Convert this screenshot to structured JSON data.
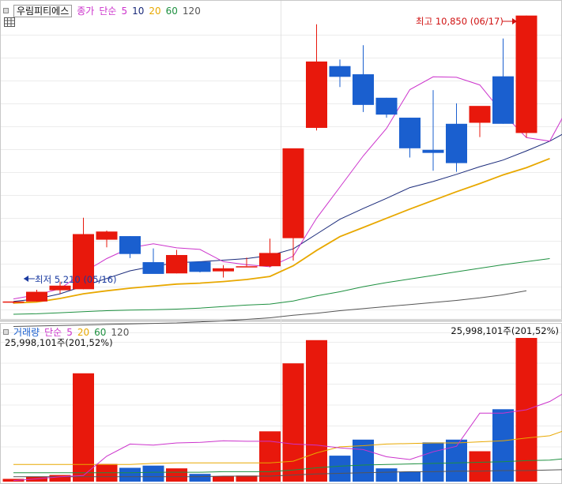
{
  "header": {
    "stock_name": "우림피티에스",
    "price_label": "종가",
    "ma_type": "단순",
    "ma_periods": [
      "5",
      "10",
      "20",
      "60",
      "120"
    ]
  },
  "volume_header": {
    "label": "거래량",
    "ma_type": "단순",
    "ma_periods": [
      "5",
      "20",
      "60",
      "120"
    ],
    "current_left": "25,998,101주(201,52%)",
    "current_right": "25,998,101주(201,52%)"
  },
  "annotations": {
    "high": "최고 10,850 (06/17)",
    "low": "최저 5,210 (05/16)"
  },
  "colors": {
    "up": "#e8180c",
    "down": "#1a5fcf",
    "ma5": "#cc33cc",
    "ma10": "#1a2a7a",
    "ma20": "#e8a800",
    "ma60": "#1e9040",
    "ma120": "#555555",
    "vma5": "#cc33cc",
    "vma20": "#e8a800",
    "vma60": "#1e9040",
    "vma120": "#555555"
  },
  "chart_data": {
    "type": "candlestick",
    "price_range": [
      5000,
      11000
    ],
    "candles": [
      {
        "o": 5250,
        "h": 5250,
        "l": 5210,
        "c": 5250
      },
      {
        "o": 5250,
        "h": 5480,
        "l": 5250,
        "c": 5440
      },
      {
        "o": 5470,
        "h": 5640,
        "l": 5400,
        "c": 5560
      },
      {
        "o": 5490,
        "h": 6890,
        "l": 5490,
        "c": 6570
      },
      {
        "o": 6460,
        "h": 6640,
        "l": 6310,
        "c": 6620
      },
      {
        "o": 6530,
        "h": 6530,
        "l": 6100,
        "c": 6180
      },
      {
        "o": 6020,
        "h": 6290,
        "l": 5820,
        "c": 5790
      },
      {
        "o": 5800,
        "h": 6260,
        "l": 5800,
        "c": 6160
      },
      {
        "o": 6030,
        "h": 6030,
        "l": 5820,
        "c": 5830
      },
      {
        "o": 5840,
        "h": 5960,
        "l": 5720,
        "c": 5900
      },
      {
        "o": 5940,
        "h": 6110,
        "l": 5940,
        "c": 5940
      },
      {
        "o": 5940,
        "h": 6480,
        "l": 5920,
        "c": 6200
      },
      {
        "o": 6490,
        "h": 7840,
        "l": 6050,
        "c": 8250
      },
      {
        "o": 8650,
        "h": 10680,
        "l": 8600,
        "c": 9950
      },
      {
        "o": 9860,
        "h": 9990,
        "l": 9450,
        "c": 9650
      },
      {
        "o": 9700,
        "h": 10270,
        "l": 8960,
        "c": 9100
      },
      {
        "o": 9240,
        "h": 9240,
        "l": 8850,
        "c": 8910
      },
      {
        "o": 8850,
        "h": 8850,
        "l": 8070,
        "c": 8250
      },
      {
        "o": 8220,
        "h": 9390,
        "l": 7810,
        "c": 8160
      },
      {
        "o": 8730,
        "h": 9130,
        "l": 7790,
        "c": 7960
      },
      {
        "o": 8750,
        "h": 9070,
        "l": 8470,
        "c": 9080
      },
      {
        "o": 9660,
        "h": 10400,
        "l": 8730,
        "c": 8730
      },
      {
        "o": 8550,
        "h": 10850,
        "l": 8460,
        "c": 10850
      }
    ],
    "ma5": [
      5300,
      5380,
      5500,
      5820,
      6090,
      6300,
      6380,
      6300,
      6270,
      6030,
      5970,
      5930,
      6140,
      6880,
      7490,
      8100,
      8640,
      9400,
      9650,
      9640,
      9490,
      8930,
      8460,
      8390,
      9230
    ],
    "ma10": [
      5250,
      5300,
      5400,
      5550,
      5700,
      5850,
      5940,
      6010,
      6030,
      6060,
      6090,
      6150,
      6280,
      6570,
      6860,
      7070,
      7270,
      7480,
      7600,
      7740,
      7890,
      8020,
      8200,
      8390,
      8640
    ],
    "ma20": [
      5220,
      5240,
      5310,
      5400,
      5460,
      5510,
      5550,
      5590,
      5610,
      5640,
      5680,
      5740,
      5950,
      6250,
      6520,
      6700,
      6880,
      7060,
      7230,
      7400,
      7560,
      7730,
      7870,
      8050
    ],
    "ma60": [
      5000,
      5010,
      5030,
      5050,
      5070,
      5080,
      5090,
      5100,
      5120,
      5150,
      5180,
      5200,
      5260,
      5360,
      5440,
      5540,
      5620,
      5690,
      5760,
      5830,
      5900,
      5970,
      6030,
      6090
    ],
    "ma120": [
      4760,
      4770,
      4780,
      4790,
      4800,
      4810,
      4820,
      4830,
      4850,
      4870,
      4900,
      4930,
      4980,
      5020,
      5070,
      5110,
      5150,
      5190,
      5230,
      5270,
      5320,
      5380,
      5460
    ],
    "volume_range": [
      0,
      26000000
    ],
    "volume": [
      500000,
      900000,
      1200000,
      19600000,
      3200000,
      2500000,
      2900000,
      2400000,
      1400000,
      1000000,
      1100000,
      9100000,
      21400000,
      25600000,
      4700000,
      7600000,
      2400000,
      1800000,
      7100000,
      7600000,
      5500000,
      13100000,
      25998101
    ],
    "volume_ma5": [
      200000,
      500000,
      900000,
      1100000,
      4600000,
      6800000,
      6600000,
      7000000,
      7100000,
      7400000,
      7300000,
      7300000,
      6800000,
      6600000,
      6100000,
      5800000,
      4500000,
      4000000,
      5400000,
      6400000,
      12400000,
      12400000,
      13000000,
      14500000,
      17000000,
      21300000
    ],
    "volume_ma20": [
      3100000,
      3100000,
      3100000,
      3100000,
      3100000,
      3100000,
      3300000,
      3400000,
      3400000,
      3400000,
      3400000,
      3400000,
      3700000,
      5200000,
      6300000,
      6500000,
      6800000,
      6900000,
      7000000,
      7000000,
      7200000,
      7400000,
      7900000,
      8300000,
      9800000
    ],
    "volume_ma60": [
      1600000,
      1600000,
      1600000,
      1600000,
      1600000,
      1600000,
      1700000,
      1700000,
      1700000,
      1800000,
      1800000,
      1800000,
      2100000,
      2500000,
      2800000,
      3000000,
      3100000,
      3200000,
      3300000,
      3400000,
      3500000,
      3600000,
      3800000,
      3900000,
      4300000
    ],
    "volume_ma120": [
      900000,
      900000,
      900000,
      900000,
      900000,
      900000,
      900000,
      900000,
      900000,
      1000000,
      1000000,
      1000000,
      1200000,
      1400000,
      1500000,
      1600000,
      1700000,
      1800000,
      1800000,
      1900000,
      1900000,
      2000000,
      2000000,
      2100000,
      2200000
    ]
  }
}
